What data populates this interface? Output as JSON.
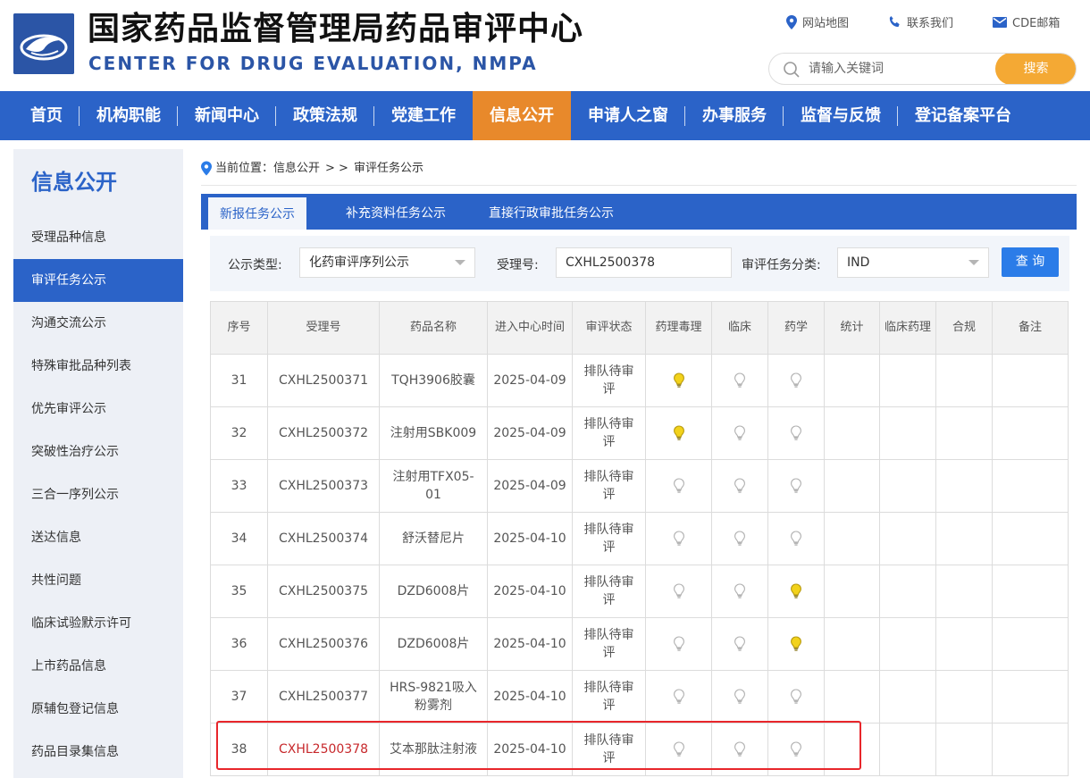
{
  "header": {
    "title": "国家药品监督管理局药品审评中心",
    "subtitle": "CENTER FOR DRUG EVALUATION, NMPA",
    "top_links": [
      {
        "label": "网站地图",
        "icon": "map-pin-icon"
      },
      {
        "label": "联系我们",
        "icon": "phone-icon"
      },
      {
        "label": "CDE邮箱",
        "icon": "mail-icon"
      }
    ],
    "search_placeholder": "请输入关键词",
    "search_button": "搜索"
  },
  "nav": {
    "items": [
      "首页",
      "机构职能",
      "新闻中心",
      "政策法规",
      "党建工作",
      "信息公开",
      "申请人之窗",
      "办事服务",
      "监督与反馈",
      "登记备案平台"
    ],
    "active": "信息公开"
  },
  "sidebar": {
    "title": "信息公开",
    "items": [
      "受理品种信息",
      "审评任务公示",
      "沟通交流公示",
      "特殊审批品种列表",
      "优先审评公示",
      "突破性治疗公示",
      "三合一序列公示",
      "送达信息",
      "共性问题",
      "临床试验默示许可",
      "上市药品信息",
      "原辅包登记信息",
      "药品目录集信息"
    ],
    "active": "审评任务公示"
  },
  "breadcrumb": {
    "prefix": "当前位置：信息公开",
    "separator": "> >",
    "current": "审评任务公示"
  },
  "tabs": {
    "items": [
      "新报任务公示",
      "补充资料任务公示",
      "直接行政审批任务公示"
    ],
    "active": "新报任务公示"
  },
  "filters": {
    "type_label": "公示类型:",
    "type_value": "化药审评序列公示",
    "number_label": "受理号:",
    "number_value": "CXHL2500378",
    "category_label": "审评任务分类:",
    "category_value": "IND",
    "query_button": "查 询"
  },
  "table": {
    "headers": [
      "序号",
      "受理号",
      "药品名称",
      "进入中心时间",
      "审评状态",
      "药理毒理",
      "临床",
      "药学",
      "统计",
      "临床药理",
      "合规",
      "备注"
    ],
    "colors": {
      "bulb_on": "#f2d21b",
      "bulb_off": "#c8c8c8",
      "highlight": "#e8262b",
      "highlight_text": "#c7282b"
    },
    "rows": [
      {
        "no": "31",
        "code": "CXHL2500371",
        "name": "TQH3906胶囊",
        "date": "2025-04-09",
        "status": "排队待审评",
        "pharm": "on",
        "clin": "off",
        "chem": "off"
      },
      {
        "no": "32",
        "code": "CXHL2500372",
        "name": "注射用SBK009",
        "date": "2025-04-09",
        "status": "排队待审评",
        "pharm": "on",
        "clin": "off",
        "chem": "off"
      },
      {
        "no": "33",
        "code": "CXHL2500373",
        "name": "注射用TFX05-01",
        "date": "2025-04-09",
        "status": "排队待审评",
        "pharm": "off",
        "clin": "off",
        "chem": "off"
      },
      {
        "no": "34",
        "code": "CXHL2500374",
        "name": "舒沃替尼片",
        "date": "2025-04-10",
        "status": "排队待审评",
        "pharm": "off",
        "clin": "off",
        "chem": "off"
      },
      {
        "no": "35",
        "code": "CXHL2500375",
        "name": "DZD6008片",
        "date": "2025-04-10",
        "status": "排队待审评",
        "pharm": "off",
        "clin": "off",
        "chem": "on"
      },
      {
        "no": "36",
        "code": "CXHL2500376",
        "name": "DZD6008片",
        "date": "2025-04-10",
        "status": "排队待审评",
        "pharm": "off",
        "clin": "off",
        "chem": "on"
      },
      {
        "no": "37",
        "code": "CXHL2500377",
        "name": "HRS-9821吸入粉雾剂",
        "date": "2025-04-10",
        "status": "排队待审评",
        "pharm": "off",
        "clin": "off",
        "chem": "off"
      },
      {
        "no": "38",
        "code": "CXHL2500378",
        "name": "艾本那肽注射液",
        "date": "2025-04-10",
        "status": "排队待审评",
        "pharm": "off",
        "clin": "off",
        "chem": "off",
        "highlight": true
      }
    ]
  }
}
